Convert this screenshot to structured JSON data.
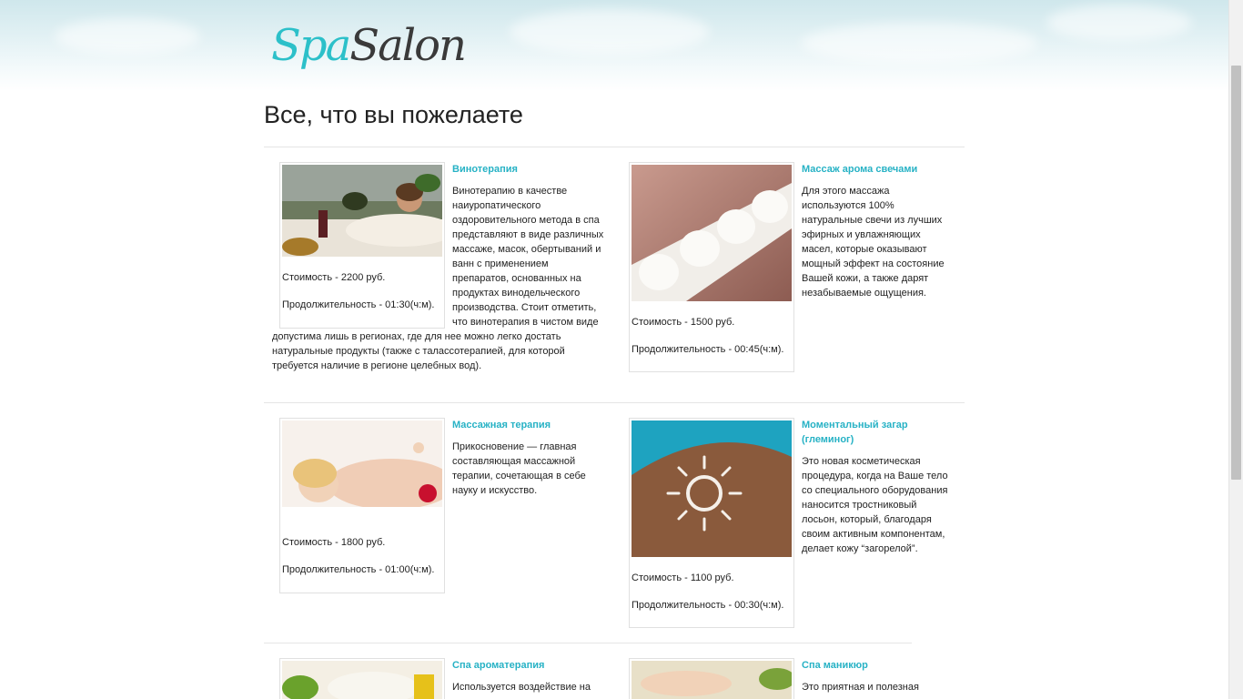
{
  "logo": {
    "part1": "Spa",
    "part2": "Salon"
  },
  "page_title": "Все, что вы пожелаете",
  "cards": [
    {
      "title": "Винотерапия",
      "desc": "Винотерапию в качестве наиуропатического оздоровительного метода в спа представляют в виде различных массаже, масок, обертываний и ванн с применением препаратов, основанных на продуктах винодельческого производства. Стоит отметить, что винотерапия в чистом виде",
      "desc_lines": [
        "Винотерапию в качестве",
        "наиуропатического",
        "оздоровительного метода в спа",
        "представляют в виде различных",
        "массаже, масок, обертываний и",
        "ванн с применением",
        "препаратов, основанных на",
        "продуктах винодельческого",
        "производства. Стоит отметить,",
        "что винотерапия в чистом виде"
      ],
      "desc_cont_lines": [
        "допустима лишь в регионах, где для нее можно легко достать",
        "натуральные продукты (также с талассотерапией, для которой",
        "требуется наличие в регионе целебных вод)."
      ],
      "cost": "Стоимость - 2200 руб.",
      "duration": "Продолжительность - 01:30(ч:м)."
    },
    {
      "title": "Массаж арома свечами",
      "desc_lines": [
        "Для этого массажа",
        "используются 100%",
        "натуральные свечи из лучших",
        "эфирных и увлажняющих",
        "масел, которые оказывают",
        "мощный эффект на состояние",
        "Вашей кожи, а также дарят",
        "незабываемые ощущения."
      ],
      "cost": "Стоимость - 1500 руб.",
      "duration": "Продолжительность - 00:45(ч:м)."
    },
    {
      "title": "Массажная терапия",
      "desc_lines": [
        "Прикосновение — главная",
        "составляющая массажной",
        "терапии, сочетающая в себе",
        "науку и искусство."
      ],
      "cost": "Стоимость - 1800 руб.",
      "duration": "Продолжительность - 01:00(ч:м)."
    },
    {
      "title_lines": [
        "Моментальный загар",
        "(глеминог)"
      ],
      "desc_lines": [
        "Это новая косметическая",
        "процедура, когда на Ваше тело",
        "со специального оборудования",
        "наносится тростниковый",
        "лосьон, который, благодаря",
        "своим активным компонентам,",
        "делает кожу “загорелой”."
      ],
      "cost": "Стоимость - 1100 руб.",
      "duration": "Продолжительность - 00:30(ч:м)."
    },
    {
      "title": "Спа ароматерапия",
      "desc_lines": [
        "Используется воздействие на"
      ]
    },
    {
      "title": "Спа маникюр",
      "desc_lines": [
        "Это приятная и полезная"
      ]
    }
  ],
  "colors": {
    "accent": "#27b2c5",
    "logo_teal": "#2cc0c9"
  }
}
